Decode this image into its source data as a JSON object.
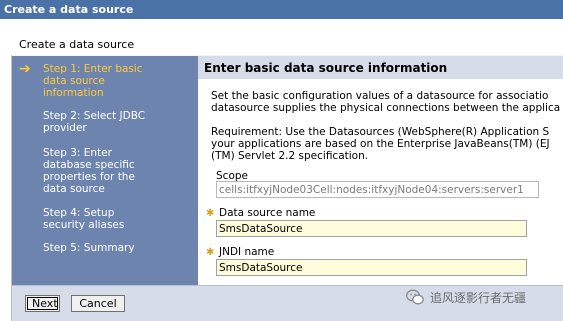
{
  "window": {
    "title": "Create a data source"
  },
  "page": {
    "subtitle": "Create a data source"
  },
  "wizard": {
    "steps": [
      {
        "label": "Step 1: Enter basic data source information",
        "lines": [
          "Step 1: Enter basic",
          "data source",
          "information"
        ],
        "active": true
      },
      {
        "label": "Step 2: Select JDBC provider",
        "lines": [
          "Step 2: Select JDBC",
          "provider"
        ],
        "active": false
      },
      {
        "label": "Step 3: Enter database specific properties for the data source",
        "lines": [
          "Step 3: Enter",
          "database specific",
          "properties for the",
          "data source"
        ],
        "active": false
      },
      {
        "label": "Step 4: Setup security aliases",
        "lines": [
          "Step 4: Setup",
          "security aliases"
        ],
        "active": false
      },
      {
        "label": "Step 5: Summary",
        "lines": [
          "Step 5: Summary"
        ],
        "active": false
      }
    ]
  },
  "content": {
    "header": "Enter basic data source information",
    "intro_lines": [
      "Set the basic configuration values of a datasource for associatio",
      "datasource supplies the physical connections between the applica"
    ],
    "requirement_lines": [
      "Requirement: Use the Datasources (WebSphere(R) Application S",
      "your applications are based on the Enterprise JavaBeans(TM) (EJ",
      "(TM) Servlet 2.2 specification."
    ],
    "scope": {
      "label": "Scope",
      "value": "cells:itfxyjNode03Cell:nodes:itfxyjNode04:servers:server1"
    },
    "datasource_name": {
      "label": "Data source name",
      "value": "SmsDataSource"
    },
    "jndi_name": {
      "label": "JNDI name",
      "value": "SmsDataSource"
    }
  },
  "buttons": {
    "next": "Next",
    "cancel": "Cancel"
  },
  "watermark": {
    "text": "追风逐影行者无疆",
    "icon": "wechat-icon"
  },
  "colors": {
    "titlebar": "#4b72a6",
    "steps_panel": "#6d85ae",
    "active_step": "#ffc83c",
    "header_band": "#d6dde9",
    "input_bg": "#fffcd9"
  }
}
